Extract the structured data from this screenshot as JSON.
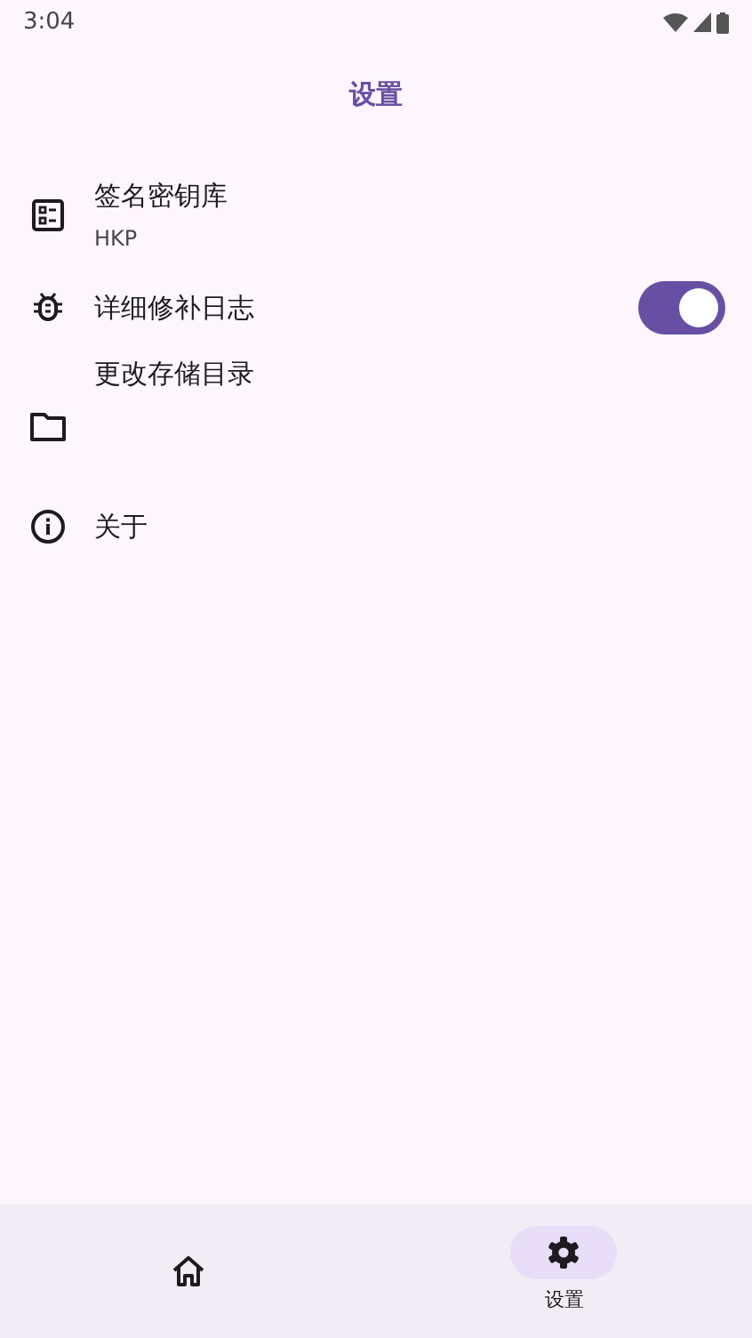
{
  "status_bar": {
    "time": "3:04"
  },
  "top_bar": {
    "title": "设置"
  },
  "settings": [
    {
      "kind": "plain",
      "title": "签名密钥库",
      "subtitle": "HKP"
    },
    {
      "kind": "switch",
      "title": "详细修补日志",
      "on": true
    },
    {
      "kind": "tall",
      "title": "更改存储目录"
    },
    {
      "kind": "plain",
      "title": "关于"
    }
  ],
  "nav": [
    {
      "selected": false
    },
    {
      "selected": true,
      "label": "设置"
    }
  ]
}
